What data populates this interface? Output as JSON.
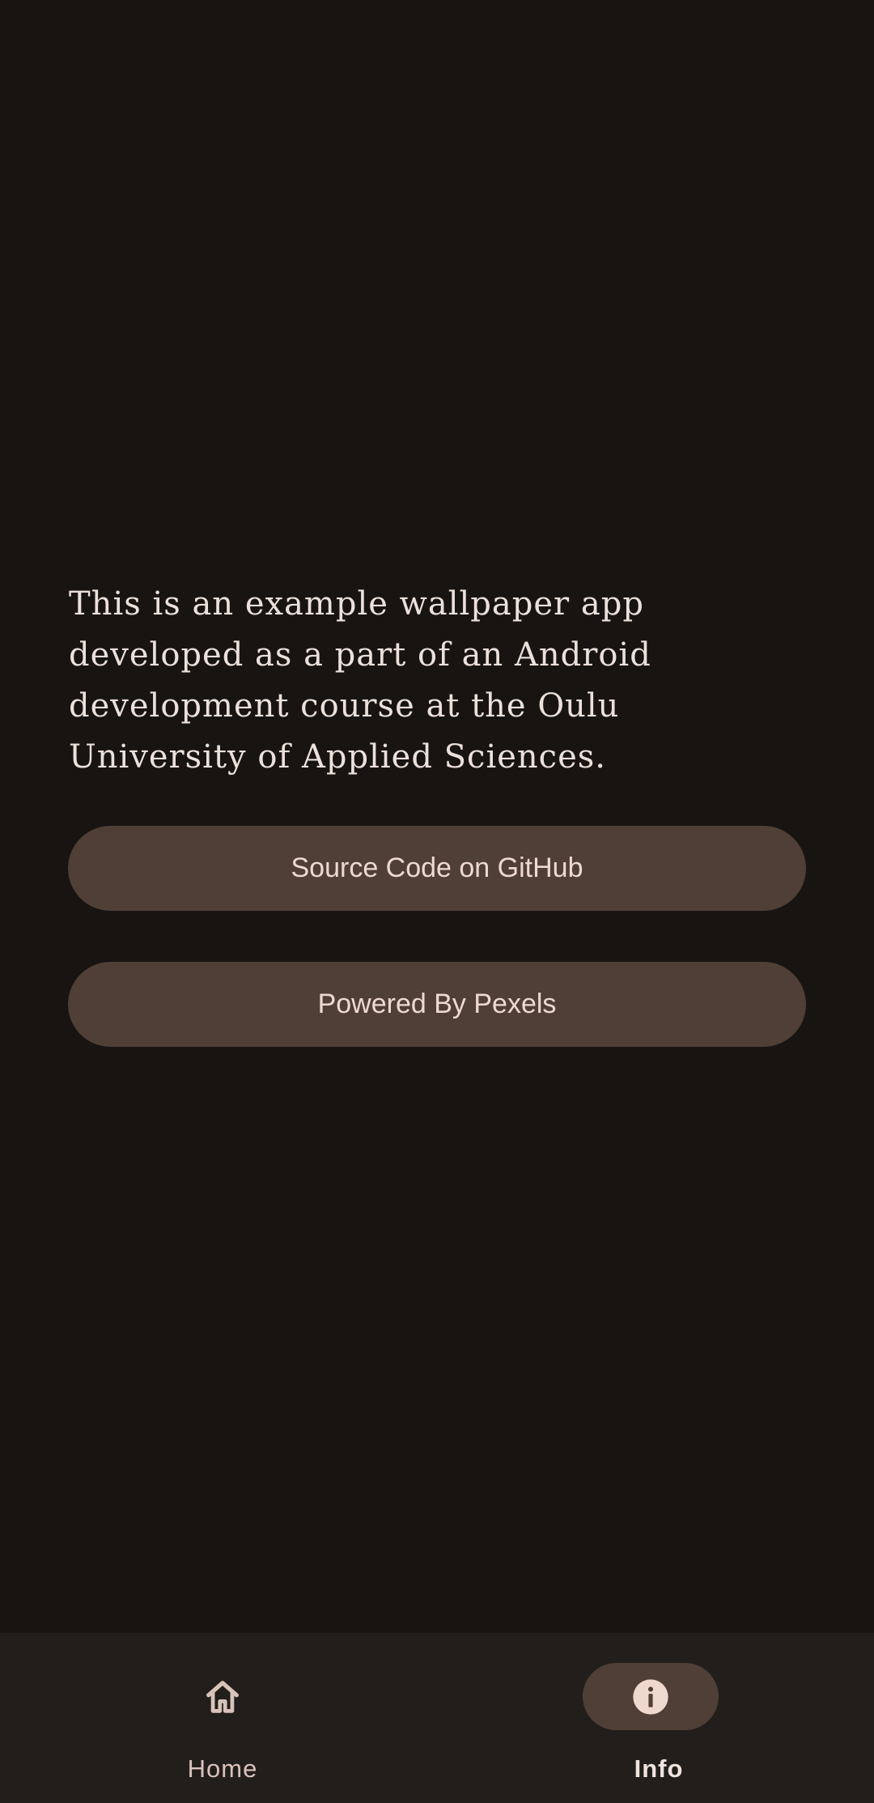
{
  "info": {
    "description": "This is an example wallpaper app developed as a part of an Android development course at the Oulu University of Applied Sciences.",
    "buttons": {
      "github": "Source Code on GitHub",
      "pexels": "Powered By Pexels"
    }
  },
  "bottom_nav": {
    "items": [
      {
        "label": "Home",
        "icon": "home-icon",
        "selected": false
      },
      {
        "label": "Info",
        "icon": "info-icon",
        "selected": true
      }
    ]
  },
  "colors": {
    "background": "#181412",
    "button_bg": "#4F3F36",
    "button_text": "#EFD9CF",
    "nav_bg": "#221E1B"
  }
}
